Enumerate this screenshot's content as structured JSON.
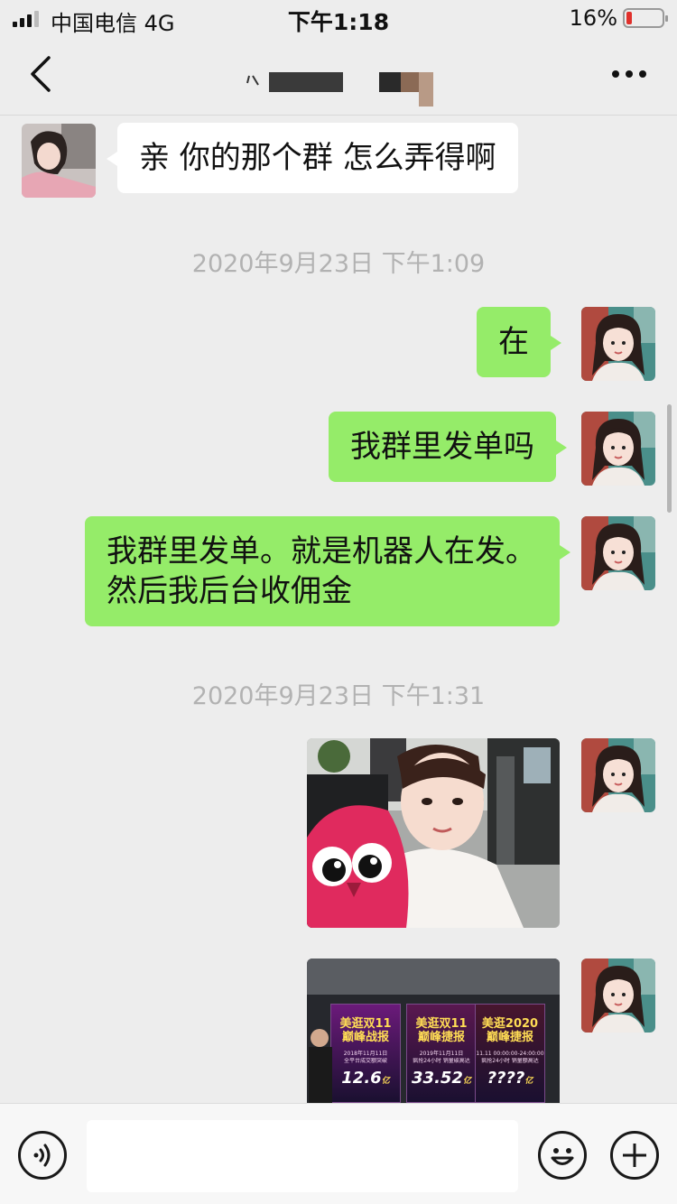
{
  "status_bar": {
    "carrier": "中国电信  4G",
    "time": "下午1:18",
    "battery": "16%",
    "battery_level": 0.16
  },
  "nav": {
    "back_icon": "chevron-left-icon",
    "more_icon": "ellipsis-icon",
    "title": "八"
  },
  "messages": [
    {
      "side": "in",
      "text": "亲 你的那个群  怎么弄得啊"
    },
    {
      "side": "stamp",
      "text": "2020年9月23日 下午1:09"
    },
    {
      "side": "out",
      "text": "在"
    },
    {
      "side": "out",
      "text": "我群里发单吗"
    },
    {
      "side": "out",
      "text": "我群里发单。就是机器人在发。然后我后台收佣金"
    },
    {
      "side": "stamp",
      "text": "2020年9月23日 下午1:31"
    },
    {
      "side": "out",
      "type": "image",
      "text": ""
    },
    {
      "side": "out",
      "type": "image",
      "text": ""
    }
  ],
  "posters": [
    {
      "title": "美逛双11\n巅峰战报",
      "date": "2018年11月11日",
      "sub": "全平台成交额突破",
      "value": "12.6",
      "unit": "亿"
    },
    {
      "title": "美逛双11\n巅峰捷报",
      "date": "2019年11月11日",
      "sub": "疯抢24小时 销量破高达",
      "value": "33.52",
      "unit": "亿"
    },
    {
      "title": "美逛2020\n巅峰捷报",
      "date": "11.11 00:00:00-24:00:00",
      "sub": "疯抢24小时 销量额高达",
      "value": "????",
      "unit": "亿"
    }
  ],
  "input_bar": {
    "voice_icon": "voice-icon",
    "emoji_icon": "emoji-icon",
    "plus_icon": "plus-icon",
    "placeholder": ""
  },
  "colors": {
    "background": "#ededed",
    "outgoing_bubble": "#95ec69",
    "incoming_bubble": "#ffffff",
    "timestamp": "#b2b2b2"
  }
}
